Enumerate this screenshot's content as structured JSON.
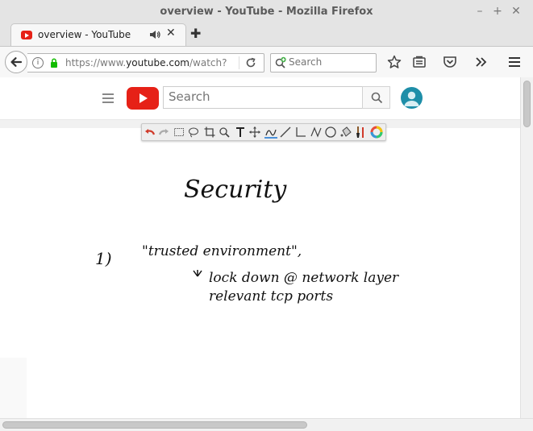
{
  "window": {
    "title": "overview - YouTube - Mozilla Firefox",
    "controls": {
      "minimize": "–",
      "maximize": "+",
      "close": "✕"
    }
  },
  "tab": {
    "title": "overview - YouTube",
    "favicon": "youtube-icon",
    "audio_icon": "speaker-icon",
    "close": "✕"
  },
  "new_tab": "✚",
  "navbar": {
    "url_host_prefix": "https://www.",
    "url_host": "youtube.com",
    "url_path": "/watch?",
    "search_placeholder": "Search"
  },
  "youtube": {
    "search_placeholder": "Search",
    "brand_color": "#e62117",
    "avatar_color": "#1e8ea8"
  },
  "whiteboard": {
    "heading": "Security",
    "item_number": "1)",
    "item_text": "\"trusted environment\",",
    "note_line_1": "lock down @ network layer",
    "note_line_2": "relevant tcp ports",
    "toolbar_tools": [
      "undo-icon",
      "redo-icon",
      "rectangle-select-icon",
      "lasso-icon",
      "crop-icon",
      "zoom-icon",
      "text-icon",
      "move-icon",
      "pen-icon",
      "line-icon",
      "rectangle-icon",
      "polyline-icon",
      "ellipse-icon",
      "fill-icon",
      "brush-icon",
      "color-wheel-icon"
    ]
  },
  "colors": {
    "toolbar_bg": "#f7f7f7",
    "titlebar_bg": "#e4e4e4",
    "accent_blue": "#4a90d9"
  }
}
